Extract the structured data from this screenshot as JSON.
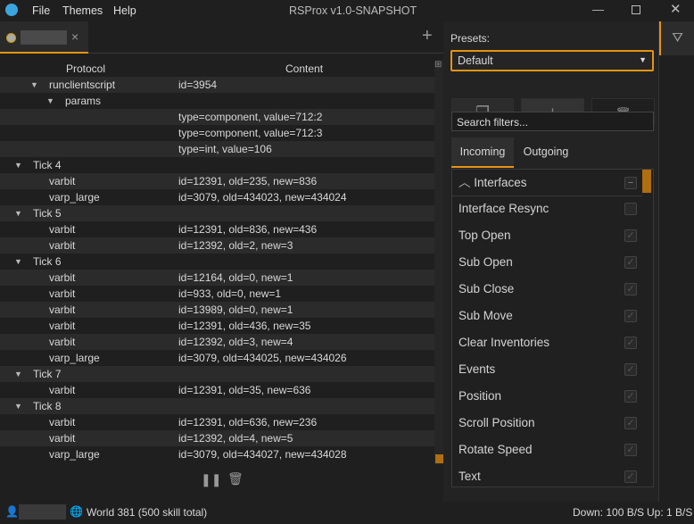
{
  "app": {
    "title": "RSProx v1.0-SNAPSHOT",
    "menu": [
      "File",
      "Themes",
      "Help"
    ]
  },
  "tab": {
    "close": "×",
    "add": "+"
  },
  "table": {
    "headers": {
      "protocol": "Protocol",
      "content": "Content"
    },
    "rows": [
      {
        "level": 1,
        "expand": true,
        "protocol": "runclientscript",
        "content": "id=3954"
      },
      {
        "level": 2,
        "expand": true,
        "protocol": "params",
        "content": ""
      },
      {
        "level": 3,
        "protocol": "",
        "content": "type=component, value=712:2"
      },
      {
        "level": 3,
        "protocol": "",
        "content": "type=component, value=712:3"
      },
      {
        "level": 3,
        "protocol": "",
        "content": "type=int, value=106"
      },
      {
        "level": 0,
        "expand": true,
        "protocol": "Tick 4",
        "content": ""
      },
      {
        "level": 1,
        "protocol": "varbit",
        "content": "id=12391, old=235, new=836"
      },
      {
        "level": 1,
        "protocol": "varp_large",
        "content": "id=3079, old=434023, new=434024"
      },
      {
        "level": 0,
        "expand": true,
        "protocol": "Tick 5",
        "content": ""
      },
      {
        "level": 1,
        "protocol": "varbit",
        "content": "id=12391, old=836, new=436"
      },
      {
        "level": 1,
        "protocol": "varbit",
        "content": "id=12392, old=2, new=3"
      },
      {
        "level": 0,
        "expand": true,
        "protocol": "Tick 6",
        "content": ""
      },
      {
        "level": 1,
        "protocol": "varbit",
        "content": "id=12164, old=0, new=1"
      },
      {
        "level": 1,
        "protocol": "varbit",
        "content": "id=933, old=0, new=1"
      },
      {
        "level": 1,
        "protocol": "varbit",
        "content": "id=13989, old=0, new=1"
      },
      {
        "level": 1,
        "protocol": "varbit",
        "content": "id=12391, old=436, new=35"
      },
      {
        "level": 1,
        "protocol": "varbit",
        "content": "id=12392, old=3, new=4"
      },
      {
        "level": 1,
        "protocol": "varp_large",
        "content": "id=3079, old=434025, new=434026"
      },
      {
        "level": 0,
        "expand": true,
        "protocol": "Tick 7",
        "content": ""
      },
      {
        "level": 1,
        "protocol": "varbit",
        "content": "id=12391, old=35, new=636"
      },
      {
        "level": 0,
        "expand": true,
        "protocol": "Tick 8",
        "content": ""
      },
      {
        "level": 1,
        "protocol": "varbit",
        "content": "id=12391, old=636, new=236"
      },
      {
        "level": 1,
        "protocol": "varbit",
        "content": "id=12392, old=4, new=5"
      },
      {
        "level": 1,
        "protocol": "varp_large",
        "content": "id=3079, old=434027, new=434028"
      }
    ]
  },
  "filters": {
    "presets_label": "Presets:",
    "preset_selected": "Default",
    "search_placeholder": "Search filters...",
    "tabs": [
      "Incoming",
      "Outgoing"
    ],
    "active_tab": "Incoming",
    "group": "Interfaces",
    "items": [
      {
        "label": "Interface Resync",
        "checked": false
      },
      {
        "label": "Top Open",
        "checked": true
      },
      {
        "label": "Sub Open",
        "checked": true
      },
      {
        "label": "Sub Close",
        "checked": true
      },
      {
        "label": "Sub Move",
        "checked": true
      },
      {
        "label": "Clear Inventories",
        "checked": true
      },
      {
        "label": "Events",
        "checked": true
      },
      {
        "label": "Position",
        "checked": true
      },
      {
        "label": "Scroll Position",
        "checked": true
      },
      {
        "label": "Rotate Speed",
        "checked": true
      },
      {
        "label": "Text",
        "checked": true
      }
    ]
  },
  "status": {
    "world": "World 381 (500 skill total)",
    "down": "Down: 100 B/S",
    "up": "Up: 1 B/S"
  },
  "colors": {
    "accent": "#e39412",
    "bg": "#1f1f1f"
  }
}
